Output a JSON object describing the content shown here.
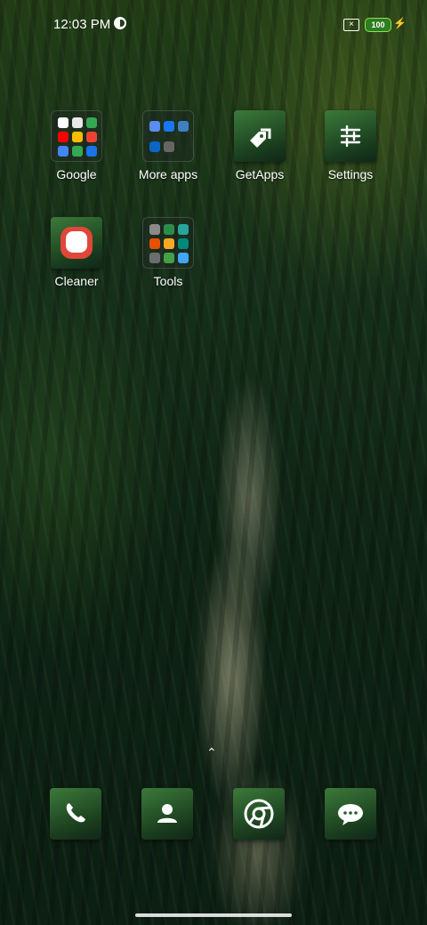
{
  "status_bar": {
    "time": "12:03 PM",
    "battery_level": "100",
    "sim_icon": "sim-missing-icon"
  },
  "apps": {
    "google": {
      "label": "Google"
    },
    "more_apps": {
      "label": "More apps"
    },
    "getapps": {
      "label": "GetApps"
    },
    "settings": {
      "label": "Settings"
    },
    "cleaner": {
      "label": "Cleaner"
    },
    "tools": {
      "label": "Tools"
    }
  },
  "dock": {
    "phone": "phone-icon",
    "contacts": "contacts-icon",
    "chrome": "chrome-icon",
    "messages": "messages-icon"
  },
  "colors": {
    "battery_green": "#2e7d20",
    "tile_green": "#3c7a3a"
  }
}
